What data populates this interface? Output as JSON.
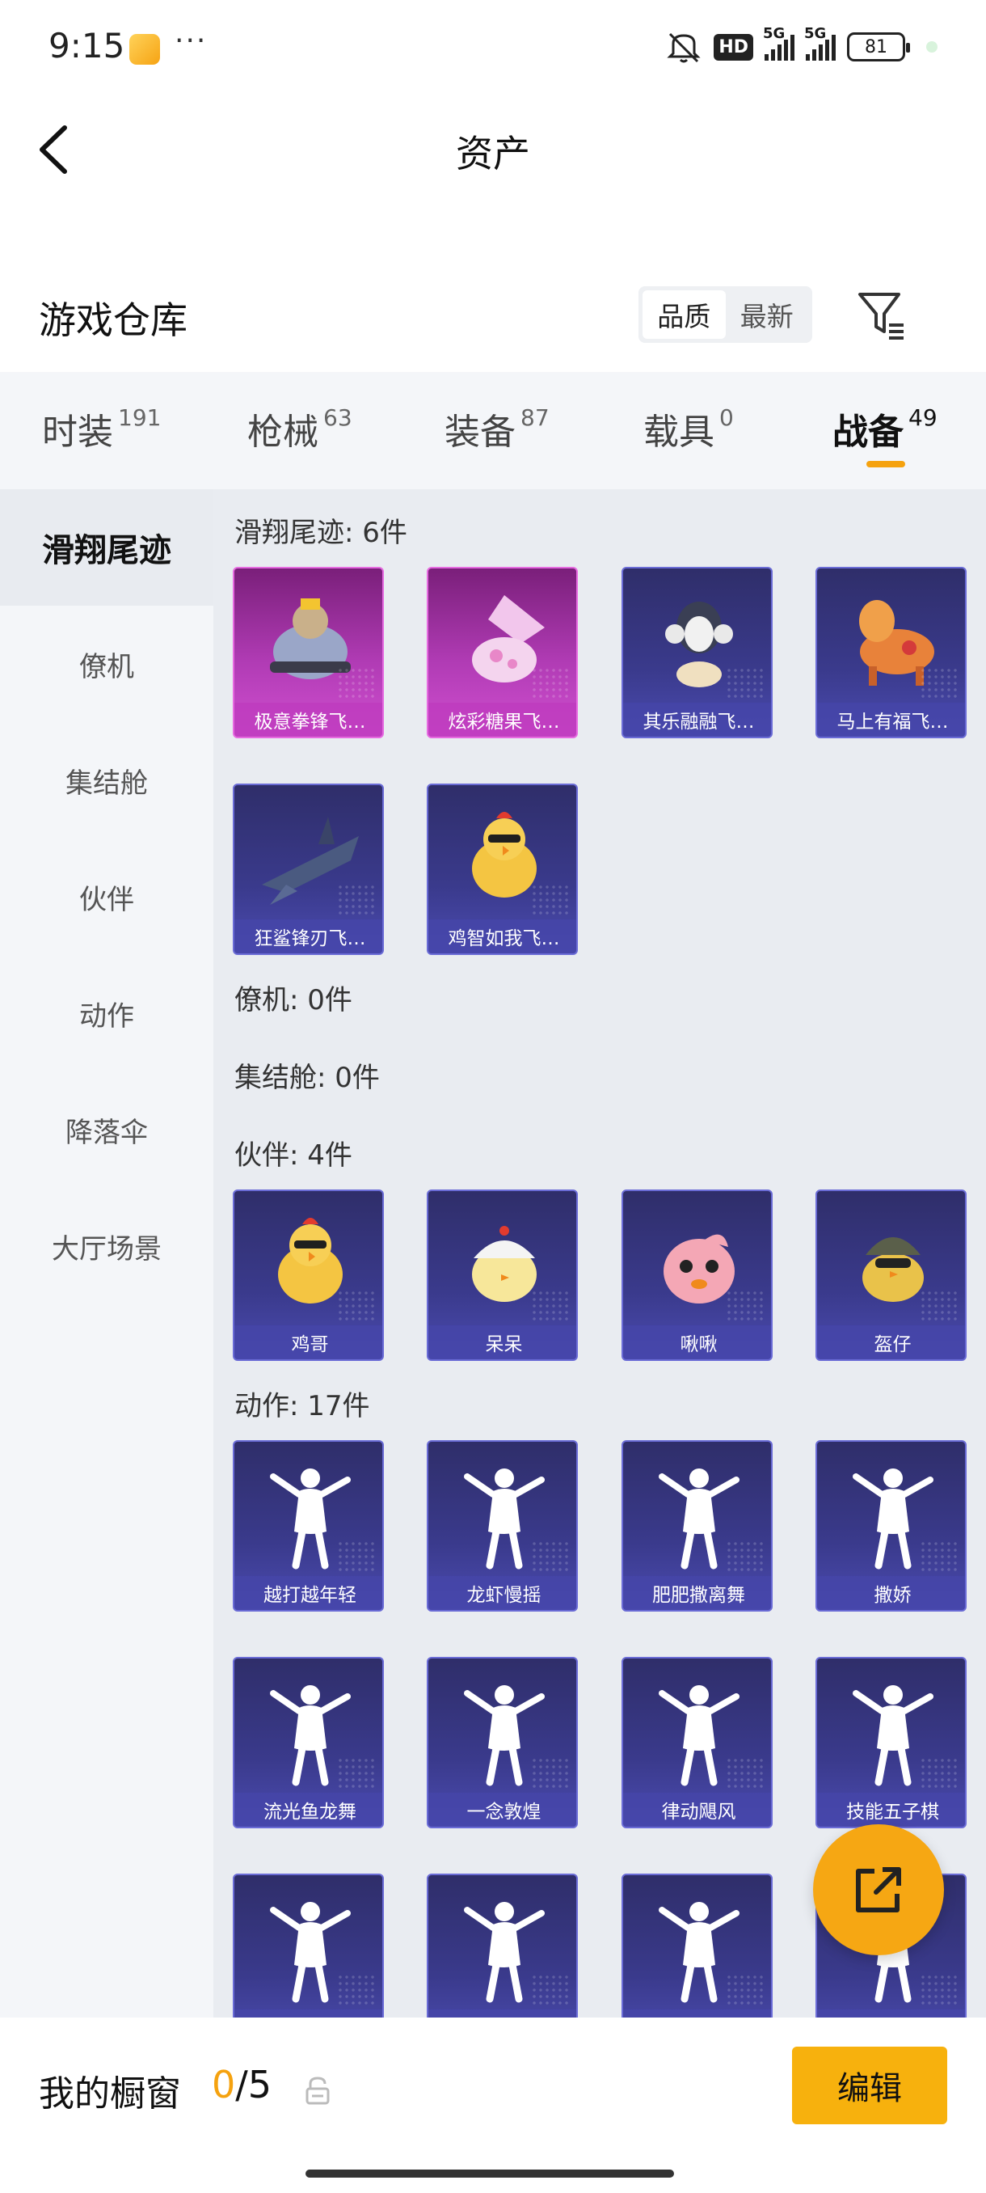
{
  "status": {
    "time": "9:15",
    "dots": "···",
    "hd": "HD",
    "sig1": "5G",
    "sig2": "5G",
    "battery": "81"
  },
  "header": {
    "title": "资产"
  },
  "warehouse": {
    "title": "游戏仓库",
    "sort_quality": "品质",
    "sort_latest": "最新"
  },
  "tabs": [
    {
      "label": "时装",
      "count": "191"
    },
    {
      "label": "枪械",
      "count": "63"
    },
    {
      "label": "装备",
      "count": "87"
    },
    {
      "label": "载具",
      "count": "0"
    },
    {
      "label": "战备",
      "count": "49"
    }
  ],
  "sidenav": [
    {
      "label": "滑翔尾迹"
    },
    {
      "label": "僚机"
    },
    {
      "label": "集结舱"
    },
    {
      "label": "伙伴"
    },
    {
      "label": "动作"
    },
    {
      "label": "降落伞"
    },
    {
      "label": "大厅场景"
    }
  ],
  "sections": {
    "glide": {
      "title": "滑翔尾迹: 6件",
      "items": [
        {
          "label": "极意拳锋飞…",
          "icon": "monkey-rider-icon"
        },
        {
          "label": "炫彩糖果飞…",
          "icon": "candy-icon"
        },
        {
          "label": "其乐融融飞…",
          "icon": "penguin-icon"
        },
        {
          "label": "马上有福飞…",
          "icon": "horse-icon"
        },
        {
          "label": "狂鲨锋刃飞…",
          "icon": "shark-icon"
        },
        {
          "label": "鸡智如我飞…",
          "icon": "chicken-icon"
        }
      ]
    },
    "wingman": {
      "title": "僚机: 0件"
    },
    "pod": {
      "title": "集结舱: 0件"
    },
    "partner": {
      "title": "伙伴: 4件",
      "items": [
        {
          "label": "鸡哥",
          "icon": "chicken-icon"
        },
        {
          "label": "呆呆",
          "icon": "chick-icon"
        },
        {
          "label": "啾啾",
          "icon": "pink-bird-icon"
        },
        {
          "label": "盔仔",
          "icon": "helmet-chick-icon"
        }
      ]
    },
    "emote": {
      "title": "动作: 17件",
      "items": [
        {
          "label": "越打越年轻",
          "icon": "dancer-icon"
        },
        {
          "label": "龙虾慢摇",
          "icon": "dancer-icon"
        },
        {
          "label": "肥肥撒离舞",
          "icon": "dancer-icon"
        },
        {
          "label": "撒娇",
          "icon": "dancer-icon"
        },
        {
          "label": "流光鱼龙舞",
          "icon": "dancer-icon"
        },
        {
          "label": "一念敦煌",
          "icon": "dancer-icon"
        },
        {
          "label": "律动飓风",
          "icon": "dancer-icon"
        },
        {
          "label": "技能五子棋",
          "icon": "dancer-icon"
        },
        {
          "label": "",
          "icon": "dancer-icon"
        },
        {
          "label": "",
          "icon": "dancer-icon"
        },
        {
          "label": "",
          "icon": "dancer-icon"
        },
        {
          "label": "",
          "icon": "dancer-icon"
        }
      ]
    }
  },
  "bottom": {
    "label": "我的橱窗",
    "current": "0",
    "sep": "/",
    "max": "5",
    "edit": "编辑"
  },
  "colors": {
    "accent": "#f5a20f",
    "card_blue": "#3a3a8c",
    "card_pink": "#b03bb4"
  }
}
